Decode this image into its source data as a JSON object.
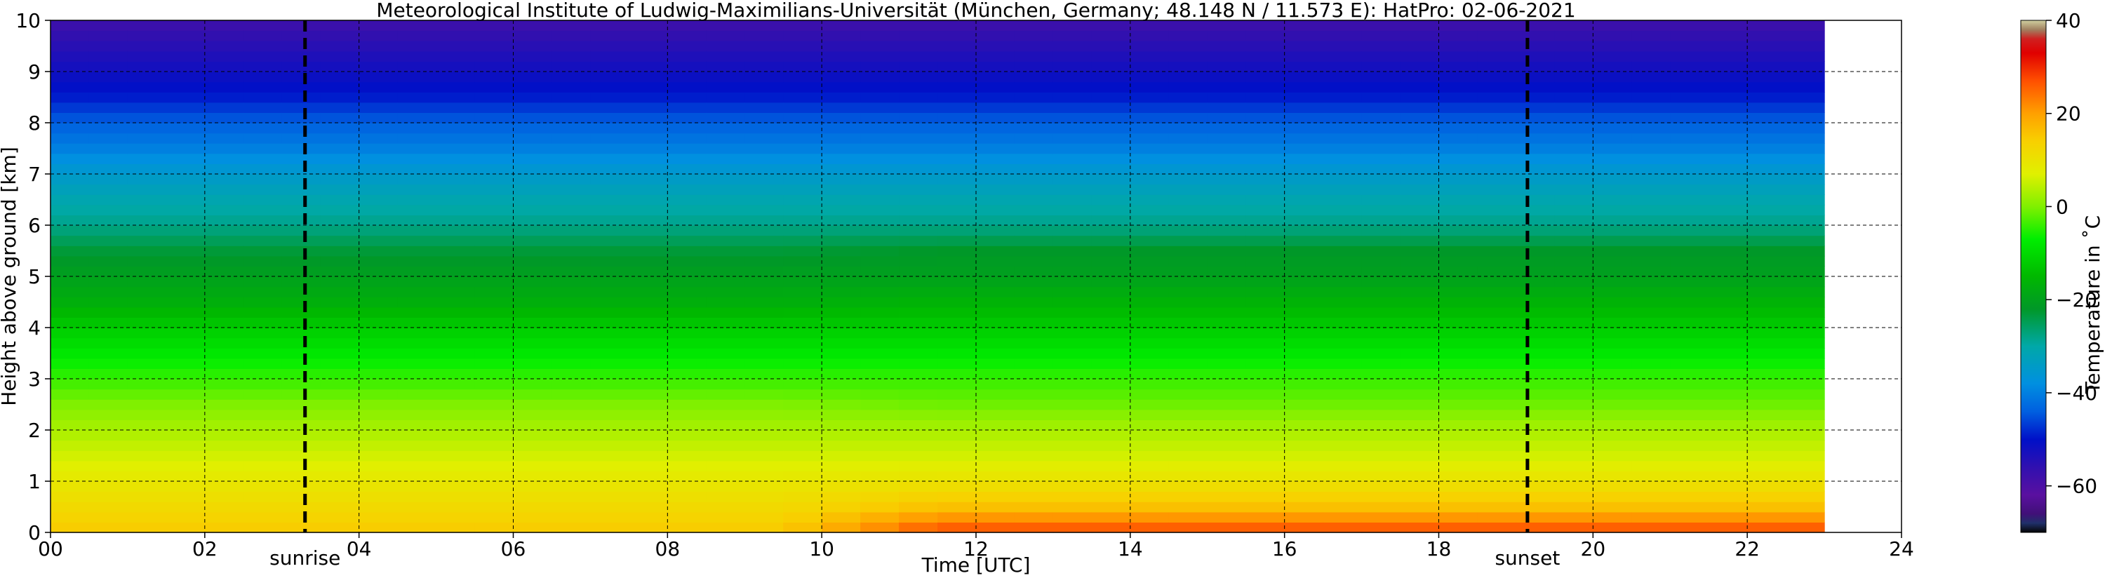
{
  "chart_data": {
    "type": "heatmap",
    "title": "Meteorological Institute of Ludwig-Maximilians-Universität (München, Germany; 48.148 N / 11.573 E):    HatPro: 02-06-2021",
    "xlabel": "Time [UTC]",
    "ylabel": "Height above ground [km]",
    "xlim": [
      0,
      24
    ],
    "ylim": [
      0,
      10
    ],
    "data_x_extent": [
      0,
      23
    ],
    "x_ticks": [
      "00",
      "02",
      "04",
      "06",
      "08",
      "10",
      "12",
      "14",
      "16",
      "18",
      "20",
      "22",
      "24"
    ],
    "y_ticks": [
      "0",
      "1",
      "2",
      "3",
      "4",
      "5",
      "6",
      "7",
      "8",
      "9",
      "10"
    ],
    "grid": true,
    "colorbar": {
      "label": "Temperature in ˚C",
      "range": [
        -70,
        40
      ],
      "ticks": [
        "40",
        "20",
        "0",
        "−20",
        "−40",
        "−60"
      ],
      "tick_values": [
        40,
        20,
        0,
        -20,
        -40,
        -60
      ],
      "stops": [
        {
          "v": -70,
          "c": "#050505"
        },
        {
          "v": -68,
          "c": "#20306a"
        },
        {
          "v": -66,
          "c": "#401078"
        },
        {
          "v": -62,
          "c": "#5a10a0"
        },
        {
          "v": -56,
          "c": "#3010b0"
        },
        {
          "v": -50,
          "c": "#0010c8"
        },
        {
          "v": -44,
          "c": "#0060e0"
        },
        {
          "v": -38,
          "c": "#0090e0"
        },
        {
          "v": -30,
          "c": "#00a8a8"
        },
        {
          "v": -22,
          "c": "#009828"
        },
        {
          "v": -15,
          "c": "#00b800"
        },
        {
          "v": -7,
          "c": "#00ee00"
        },
        {
          "v": 0,
          "c": "#80f000"
        },
        {
          "v": 7,
          "c": "#e0f000"
        },
        {
          "v": 14,
          "c": "#f8d000"
        },
        {
          "v": 20,
          "c": "#ffa000"
        },
        {
          "v": 27,
          "c": "#ff5000"
        },
        {
          "v": 33,
          "c": "#e00000"
        },
        {
          "v": 36,
          "c": "#d02020"
        },
        {
          "v": 38,
          "c": "#a08060"
        },
        {
          "v": 40,
          "c": "#d0d0a0"
        }
      ]
    },
    "temperature_profile": {
      "heights_km": [
        0,
        0.5,
        1,
        1.5,
        2,
        2.5,
        3,
        3.5,
        4,
        4.5,
        5,
        5.5,
        6,
        6.5,
        7,
        7.5,
        8,
        8.5,
        9,
        9.5,
        10
      ],
      "night_C": [
        15,
        12,
        9,
        6,
        3,
        0,
        -4,
        -8,
        -12,
        -17,
        -20,
        -23,
        -28,
        -31,
        -35,
        -40,
        -44,
        -49,
        -52,
        -55,
        -58
      ],
      "afternoon_C": [
        28,
        16,
        10,
        6,
        3,
        -1,
        -4,
        -8,
        -12,
        -16,
        -20,
        -22,
        -28,
        -31,
        -35,
        -40,
        -44,
        -49,
        -52,
        -55,
        -58
      ]
    },
    "annotations": [
      {
        "label": "sunrise",
        "x": 3.3
      },
      {
        "label": "sunset",
        "x": 19.15
      }
    ]
  }
}
